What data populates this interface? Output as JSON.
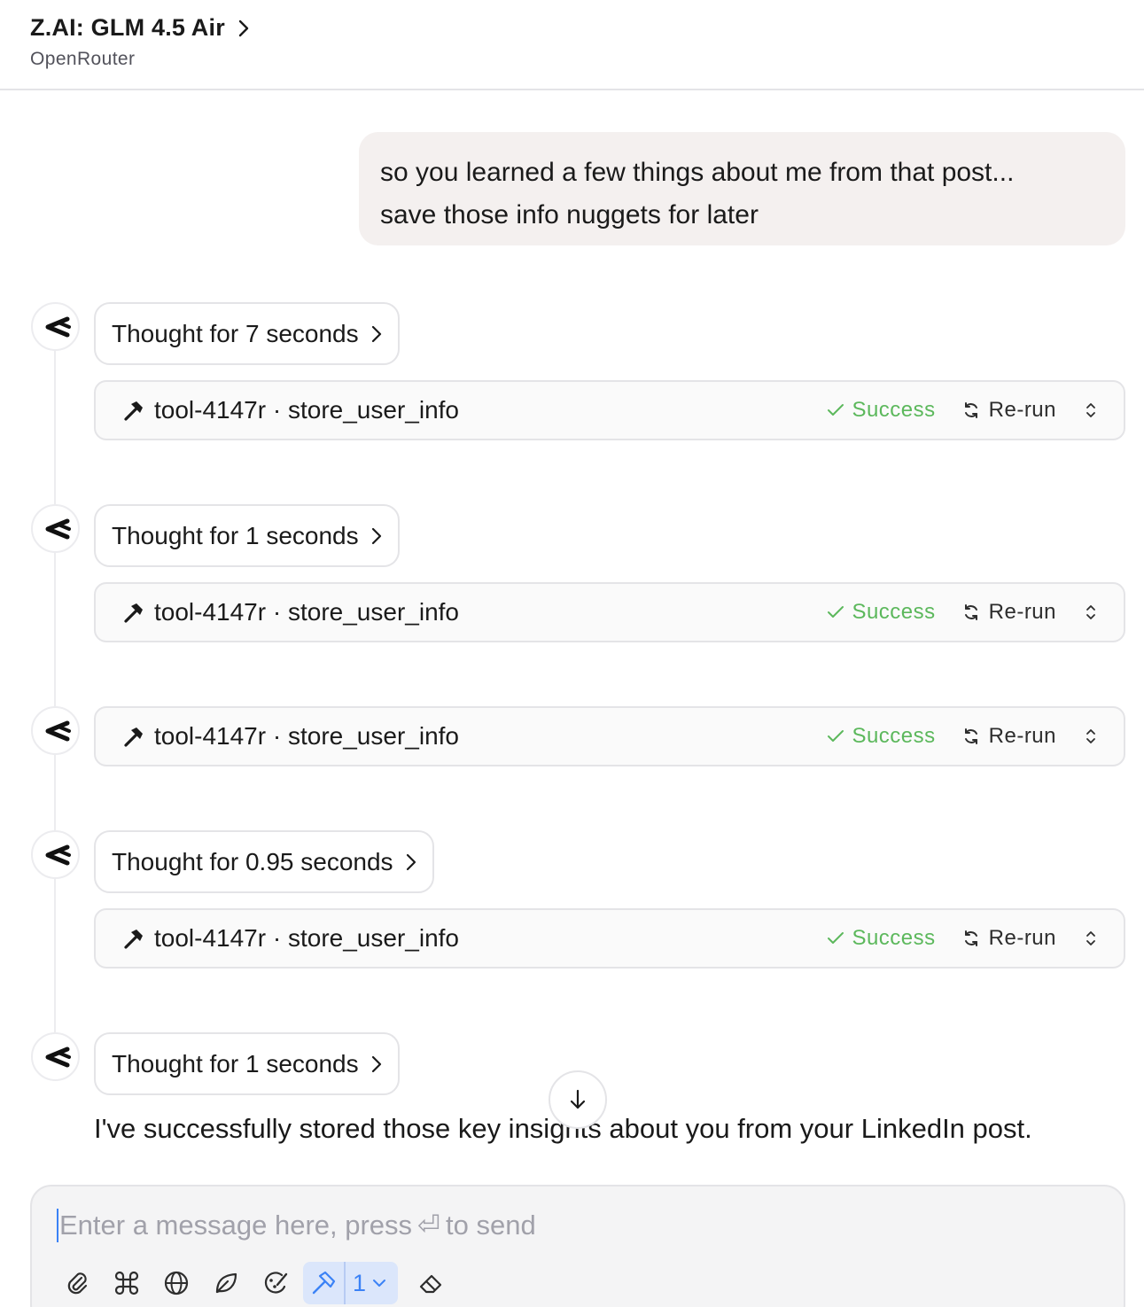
{
  "header": {
    "model_name": "Z.AI: GLM 4.5 Air",
    "provider": "OpenRouter"
  },
  "user_message": {
    "line1": "so you learned a few things about me from that post...",
    "line2": "save those info nuggets for later"
  },
  "blocks": [
    {
      "thought": "Thought for 7 seconds",
      "tool": {
        "id": "tool-4147r",
        "separator": "·",
        "name": "store_user_info",
        "status": "Success",
        "action": "Re-run"
      }
    },
    {
      "thought": "Thought for 1 seconds",
      "tool": {
        "id": "tool-4147r",
        "separator": "·",
        "name": "store_user_info",
        "status": "Success",
        "action": "Re-run"
      }
    },
    {
      "tool": {
        "id": "tool-4147r",
        "separator": "·",
        "name": "store_user_info",
        "status": "Success",
        "action": "Re-run"
      }
    },
    {
      "thought": "Thought for 0.95 seconds",
      "tool": {
        "id": "tool-4147r",
        "separator": "·",
        "name": "store_user_info",
        "status": "Success",
        "action": "Re-run"
      }
    },
    {
      "thought": "Thought for 1 seconds"
    }
  ],
  "answer": "I've successfully stored those key insights about you from your LinkedIn post.",
  "composer": {
    "placeholder_before": "Enter a message here, press",
    "placeholder_glyph": "⏎",
    "placeholder_after": "to send",
    "tools_count": "1"
  },
  "colors": {
    "success": "#5cb85c",
    "accent": "#3b82f6",
    "user_bubble": "#f4f0ef"
  },
  "icons": [
    "chevron-right-icon",
    "glm-logo-icon",
    "hammer-icon",
    "check-icon",
    "refresh-icon",
    "chevron-up-down-icon",
    "arrow-down-icon",
    "paperclip-icon",
    "command-icon",
    "globe-icon",
    "leaf-icon",
    "palette-icon",
    "chevron-down-icon",
    "eraser-icon"
  ]
}
